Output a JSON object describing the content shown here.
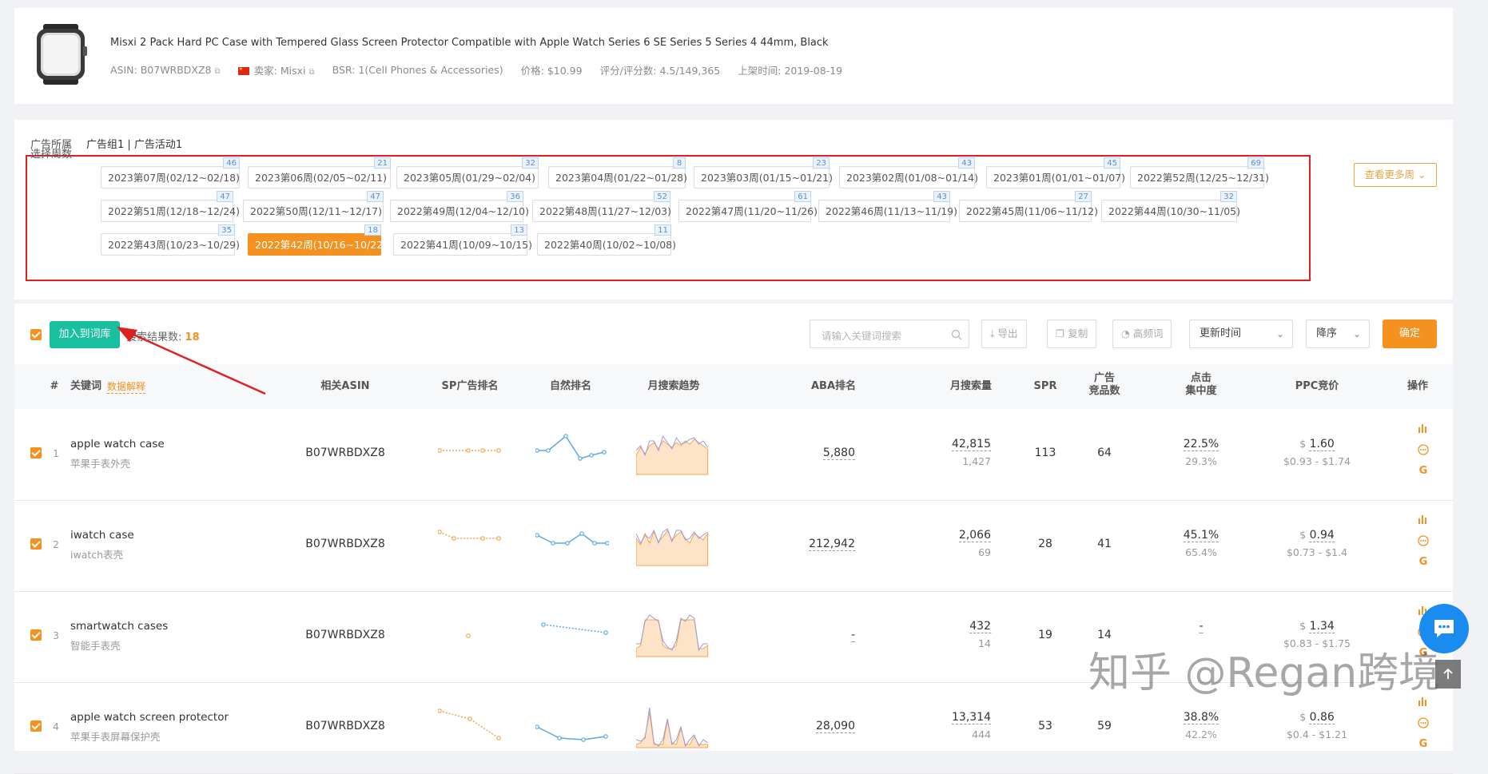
{
  "product": {
    "title": "Misxi 2 Pack Hard PC Case with Tempered Glass Screen Protector Compatible with Apple Watch Series 6 SE Series 5 Series 4 44mm, Black",
    "asin_label": "ASIN: B07WRBDXZ8",
    "seller_label": "卖家: Misxi",
    "bsr_label": "BSR: 1(Cell Phones & Accessories)",
    "price_label": "价格: $10.99",
    "rating_label": "评分/评分数: 4.5/149,365",
    "listed_label": "上架时间: 2019-08-19"
  },
  "ad_group": {
    "label": "广告所属",
    "value": "广告组1 | 广告活动1"
  },
  "weeks": {
    "label": "选择周数",
    "more_button": "查看更多周",
    "rows": [
      [
        {
          "label": "2023第07周(02/12~02/18)",
          "count": "46"
        },
        {
          "label": "2023第06周(02/05~02/11)",
          "count": "21"
        },
        {
          "label": "2023第05周(01/29~02/04)",
          "count": "32"
        },
        {
          "label": "2023第04周(01/22~01/28)",
          "count": "8"
        },
        {
          "label": "2023第03周(01/15~01/21)",
          "count": "23"
        },
        {
          "label": "2023第02周(01/08~01/14)",
          "count": "43"
        },
        {
          "label": "2023第01周(01/01~01/07)",
          "count": "45"
        },
        {
          "label": "2022第52周(12/25~12/31)",
          "count": "69"
        }
      ],
      [
        {
          "label": "2022第51周(12/18~12/24)",
          "count": "47"
        },
        {
          "label": "2022第50周(12/11~12/17)",
          "count": "47"
        },
        {
          "label": "2022第49周(12/04~12/10)",
          "count": "36"
        },
        {
          "label": "2022第48周(11/27~12/03)",
          "count": "52"
        },
        {
          "label": "2022第47周(11/20~11/26)",
          "count": "61"
        },
        {
          "label": "2022第46周(11/13~11/19)",
          "count": "43"
        },
        {
          "label": "2022第45周(11/06~11/12)",
          "count": "27"
        },
        {
          "label": "2022第44周(10/30~11/05)",
          "count": "32"
        }
      ],
      [
        {
          "label": "2022第43周(10/23~10/29)",
          "count": "35"
        },
        {
          "label": "2022第42周(10/16~10/22)",
          "count": "18",
          "active": true
        },
        {
          "label": "2022第41周(10/09~10/15)",
          "count": "13"
        },
        {
          "label": "2022第40周(10/02~10/08)",
          "count": "11"
        }
      ]
    ]
  },
  "toolbar": {
    "add_button": "加入到词库",
    "result_count_label": "搜索结果数:",
    "result_count": "18",
    "search_placeholder": "请输入关键词搜索",
    "export": "导出",
    "copy": "复制",
    "freq_words": "高频词",
    "sort_field": "更新时间",
    "sort_order": "降序",
    "confirm": "确定"
  },
  "table": {
    "headers": {
      "index": "#",
      "keyword": "关键词",
      "data_explain": "数据解释",
      "asin": "相关ASIN",
      "sp_rank": "SP广告排名",
      "organic_rank": "自然排名",
      "trend": "月搜索趋势",
      "aba": "ABA排名",
      "monthly_search": "月搜索量",
      "spr": "SPR",
      "ad_products_1": "广告",
      "ad_products_2": "竞品数",
      "click_conc_1": "点击",
      "click_conc_2": "集中度",
      "ppc": "PPC竞价",
      "actions": "操作"
    },
    "rows": [
      {
        "index": "1",
        "keyword": "apple watch case",
        "keyword_cn": "苹果手表外壳",
        "asin": "B07WRBDXZ8",
        "aba": "5,880",
        "search": "42,815",
        "search_sub": "1,427",
        "spr": "113",
        "ad_products": "64",
        "click1": "22.5%",
        "click2": "29.3%",
        "ppc": "1.60",
        "ppc_range": "$0.93 - $1.74"
      },
      {
        "index": "2",
        "keyword": "iwatch case",
        "keyword_cn": "iwatch表壳",
        "asin": "B07WRBDXZ8",
        "aba": "212,942",
        "search": "2,066",
        "search_sub": "69",
        "spr": "28",
        "ad_products": "41",
        "click1": "45.1%",
        "click2": "65.4%",
        "ppc": "0.94",
        "ppc_range": "$0.73 - $1.4"
      },
      {
        "index": "3",
        "keyword": "smartwatch cases",
        "keyword_cn": "智能手表壳",
        "asin": "B07WRBDXZ8",
        "aba": "-",
        "search": "432",
        "search_sub": "14",
        "spr": "19",
        "ad_products": "14",
        "click1": "-",
        "click2": "",
        "ppc": "1.34",
        "ppc_range": "$0.83 - $1.75"
      },
      {
        "index": "4",
        "keyword": "apple watch screen protector",
        "keyword_cn": "苹果手表屏幕保护壳",
        "asin": "B07WRBDXZ8",
        "aba": "28,090",
        "search": "13,314",
        "search_sub": "444",
        "spr": "53",
        "ad_products": "59",
        "click1": "38.8%",
        "click2": "42.2%",
        "ppc": "0.86",
        "ppc_range": "$0.4 - $1.21"
      }
    ],
    "currency_symbol": "$"
  },
  "watermark": "知乎 @Regan跨境",
  "colors": {
    "accent": "#f5911e",
    "green": "#18c0a0",
    "red_box": "#e02020",
    "badge_blue": "#5b8fd6",
    "chart_blue": "#5aa9e6",
    "chart_orange": "#f5a64a"
  }
}
